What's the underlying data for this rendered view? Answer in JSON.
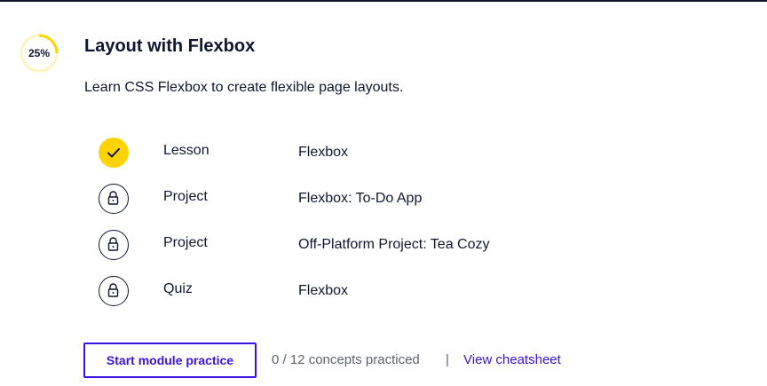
{
  "module": {
    "progress": {
      "percent": 25,
      "label": "25%",
      "color": "#ffd300",
      "track_color": "#fff4bf"
    },
    "title": "Layout with Flexbox",
    "description": "Learn CSS Flexbox to create flexible page layouts."
  },
  "items": [
    {
      "status": "complete",
      "icon": "check-icon",
      "type": "Lesson",
      "name": "Flexbox"
    },
    {
      "status": "locked",
      "icon": "lock-icon",
      "type": "Project",
      "name": "Flexbox: To-Do App"
    },
    {
      "status": "locked",
      "icon": "lock-icon",
      "type": "Project",
      "name": "Off-Platform Project: Tea Cozy"
    },
    {
      "status": "locked",
      "icon": "lock-icon",
      "type": "Quiz",
      "name": "Flexbox"
    }
  ],
  "footer": {
    "practice_button_label": "Start module practice",
    "concepts_text": "0 / 12 concepts practiced",
    "separator": "|",
    "cheatsheet_link": "View cheatsheet"
  },
  "colors": {
    "accent": "#3a10e5",
    "complete": "#ffd300",
    "text": "#10162f",
    "muted": "#5c6270"
  }
}
